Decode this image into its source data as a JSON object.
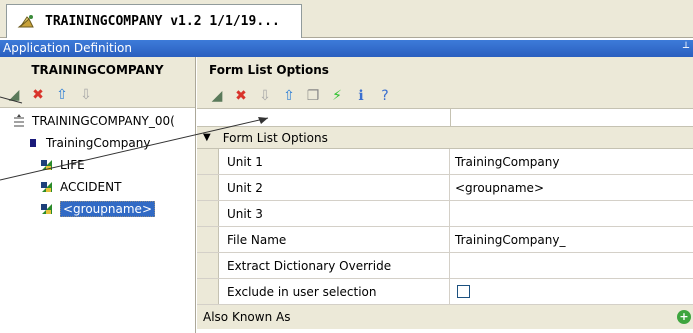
{
  "tab": {
    "title": "TRAININGCOMPANY v1.2 1/1/19..."
  },
  "titlebar": {
    "title": "Application Definition",
    "pin_glyph": "┴"
  },
  "left_pane": {
    "header": "TRAININGCOMPANY",
    "toolbar": [
      {
        "icon": "add-node-icon",
        "glyph": "◢",
        "color": "#5a7a5a"
      },
      {
        "icon": "delete-icon",
        "glyph": "✖",
        "color": "#d9342b"
      },
      {
        "icon": "move-up-icon",
        "glyph": "⇧",
        "color": "#2e7fd6"
      },
      {
        "icon": "move-down-icon",
        "glyph": "⇩",
        "color": "#a8a8a8"
      }
    ],
    "tree": [
      {
        "label": "TRAININGCOMPANY_00(",
        "indent": 0,
        "icon": "root-icon"
      },
      {
        "label": "TrainingCompany",
        "indent": 1,
        "icon": "folder-icon"
      },
      {
        "label": "LIFE",
        "indent": 2,
        "icon": "group-icon"
      },
      {
        "label": "ACCIDENT",
        "indent": 2,
        "icon": "group-icon"
      },
      {
        "label": "<groupname>",
        "indent": 2,
        "icon": "group-icon",
        "selected": true
      }
    ]
  },
  "right_pane": {
    "header": "Form List Options",
    "toolbar": [
      {
        "icon": "add-node-icon",
        "glyph": "◢",
        "color": "#5a7a5a"
      },
      {
        "icon": "delete-icon",
        "glyph": "✖",
        "color": "#d9342b"
      },
      {
        "icon": "move-down-icon",
        "glyph": "⇩",
        "color": "#a8a8a8"
      },
      {
        "icon": "move-up-icon",
        "glyph": "⇧",
        "color": "#2e7fd6"
      },
      {
        "icon": "copy-icon",
        "glyph": "❐",
        "color": "#888888"
      },
      {
        "icon": "lightning-icon",
        "glyph": "⚡",
        "color": "#2fc12f"
      },
      {
        "icon": "info-icon",
        "glyph": "ℹ",
        "color": "#3a6fd0"
      },
      {
        "icon": "help-icon",
        "glyph": "?",
        "color": "#3a6fd0"
      }
    ],
    "category": "Form List Options",
    "rows": [
      {
        "name": "Unit 1",
        "value": "TrainingCompany"
      },
      {
        "name": "Unit 2",
        "value": "<groupname>"
      },
      {
        "name": "Unit 3",
        "value": ""
      },
      {
        "name": "File Name",
        "value": "TrainingCompany_"
      },
      {
        "name": "Extract Dictionary Override",
        "value": ""
      },
      {
        "name": "Exclude in user selection",
        "value": "",
        "checkbox": true,
        "checked": false
      }
    ],
    "last_row": {
      "name": "Also Known As",
      "add_glyph": "+"
    }
  }
}
